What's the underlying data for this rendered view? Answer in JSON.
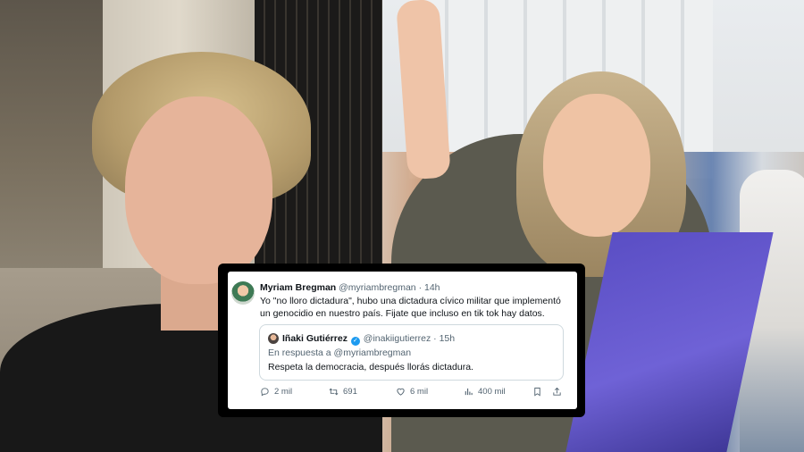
{
  "tweet": {
    "author_name": "Myriam Bregman",
    "author_handle": "@myriambregman",
    "separator": "·",
    "time": "14h",
    "text": "Yo \"no lloro dictadura\", hubo una dictadura cívico militar que implementó un genocidio en nuestro país. Fijate que incluso en tik tok hay datos.",
    "quoted": {
      "author_name": "Iñaki Gutiérrez",
      "verified_icon": "verified-badge-icon",
      "author_handle": "@inakiigutierrez",
      "time": "15h",
      "reply_to": "En respuesta a @myriambregman",
      "text": "Respeta la democracia, después llorás dictadura."
    },
    "stats": {
      "replies": "2 mil",
      "retweets": "691",
      "likes": "6 mil",
      "views": "400 mil"
    }
  },
  "colors": {
    "text_primary": "#0f1419",
    "text_secondary": "#536471",
    "verified": "#1d9bf0",
    "border": "#cfd9de"
  }
}
